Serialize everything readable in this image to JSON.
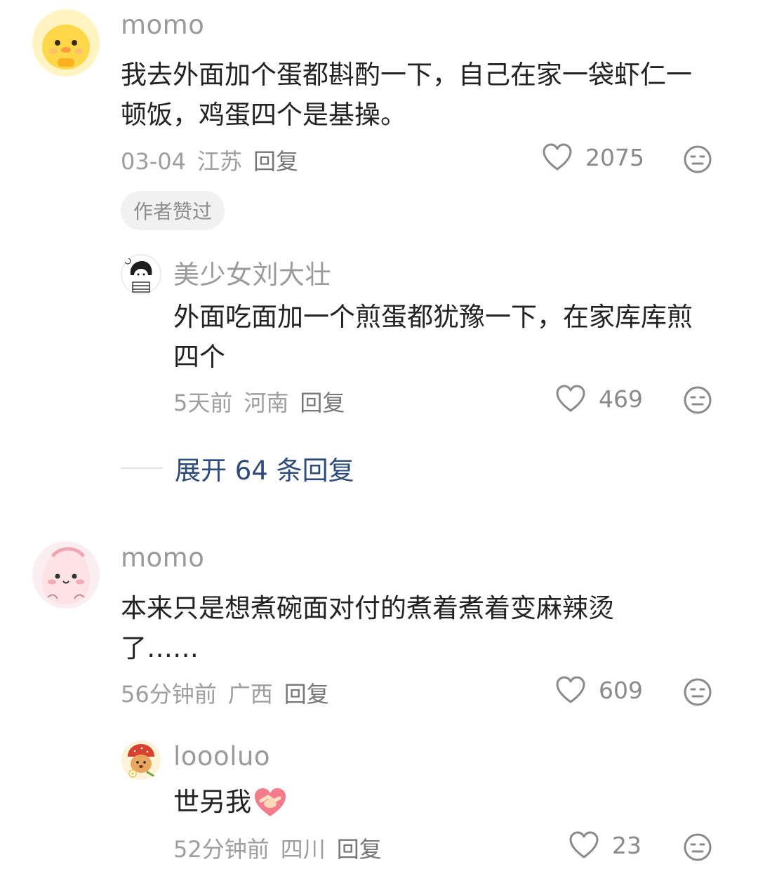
{
  "comments": [
    {
      "username": "momo",
      "content": "我去外面加个蛋都斟酌一下，自己在家一袋虾仁一顿饭，鸡蛋四个是基操。",
      "date": "03-04",
      "location": "江苏",
      "reply_label": "回复",
      "likes": "2075",
      "badge": "作者赞过",
      "avatar_icon": "yellow-chick-avatar",
      "reply": {
        "username": "美少女刘大壮",
        "content": "外面吃面加一个煎蛋都犹豫一下，在家库库煎四个",
        "date": "5天前",
        "location": "河南",
        "reply_label": "回复",
        "likes": "469",
        "avatar_icon": "cartoon-girl-avatar"
      },
      "expand_label": "展开 64 条回复"
    },
    {
      "username": "momo",
      "content": "本来只是想煮碗面对付的煮着煮着变麻辣烫了……",
      "date": "56分钟前",
      "location": "广西",
      "reply_label": "回复",
      "likes": "609",
      "avatar_icon": "pink-blob-avatar",
      "reply": {
        "username": "loooluo",
        "content": "世另我",
        "emoji": "handshake-heart-emoji",
        "date": "52分钟前",
        "location": "四川",
        "reply_label": "回复",
        "likes": "23",
        "avatar_icon": "strawberry-bear-avatar"
      }
    }
  ],
  "colors": {
    "username": "#9a9a9a",
    "meta": "#9e9e9e",
    "expand_link": "#2d4a7a",
    "badge_bg": "#f1f1f1"
  }
}
